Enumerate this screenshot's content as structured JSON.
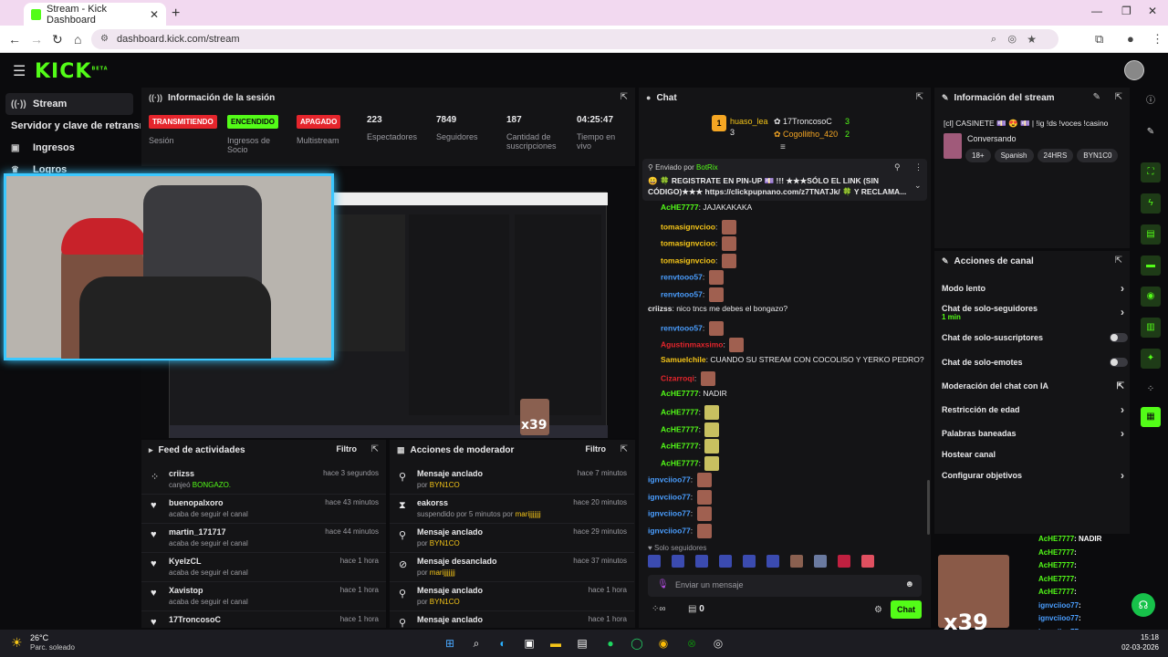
{
  "browser": {
    "tab_title": "Stream - Kick Dashboard",
    "url": "dashboard.kick.com/stream"
  },
  "kick": {
    "logo": "KICK",
    "logo_badge": "BETA"
  },
  "sidebar": {
    "items": [
      {
        "label": "Stream",
        "icon": "broadcast-icon"
      },
      {
        "label": "Servidor y clave de retransmisión",
        "icon": ""
      },
      {
        "label": "Ingresos",
        "icon": "money-icon"
      },
      {
        "label": "Logros",
        "icon": "trophy-icon"
      }
    ]
  },
  "session": {
    "title": "Información de la sesión",
    "cols": [
      {
        "badge": "TRANSMITIENDO",
        "badge_color": "#e5252c",
        "label": "Sesión"
      },
      {
        "badge": "ENCENDIDO",
        "badge_color": "#53fc18",
        "label": "Ingresos de Socio"
      },
      {
        "badge": "APAGADO",
        "badge_color": "#e5252c",
        "label": "Multistream"
      },
      {
        "value": "223",
        "label": "Espectadores"
      },
      {
        "value": "7849",
        "label": "Seguidores"
      },
      {
        "value": "187",
        "label": "Cantidad de suscripciones"
      },
      {
        "value": "04:25:47",
        "label": "Tiempo en vivo"
      }
    ]
  },
  "overlay": {
    "counter": "x39"
  },
  "feed": {
    "title": "Feed de actividades",
    "filter": "Filtro",
    "rows": [
      {
        "name": "criizss",
        "sub_prefix": "canjeó ",
        "sub_highlight": "BONGAZO.",
        "time": "hace 3 segundos",
        "icon": "redeem-icon"
      },
      {
        "name": "buenopalxoro",
        "sub": "acaba de seguir el canal",
        "time": "hace 43 minutos",
        "icon": "heart-icon"
      },
      {
        "name": "martin_171717",
        "sub": "acaba de seguir el canal",
        "time": "hace 44 minutos",
        "icon": "heart-icon"
      },
      {
        "name": "KyelzCL",
        "sub": "acaba de seguir el canal",
        "time": "hace 1 hora",
        "icon": "heart-icon"
      },
      {
        "name": "Xavistop",
        "sub": "acaba de seguir el canal",
        "time": "hace 1 hora",
        "icon": "heart-icon"
      },
      {
        "name": "17TroncosoC",
        "sub": "",
        "time": "hace 1 hora",
        "icon": "heart-icon"
      }
    ]
  },
  "modactions": {
    "title": "Acciones de moderador",
    "filter": "Filtro",
    "rows": [
      {
        "name": "Mensaje anclado",
        "by": "por ",
        "who": "BYN1CO",
        "time": "hace 7 minutos",
        "icon": "pin-icon"
      },
      {
        "name": "eakorss",
        "by": "suspendido por 5 minutos por ",
        "who": "marijjjjjjj",
        "time": "hace 20 minutos",
        "icon": "hourglass-icon"
      },
      {
        "name": "Mensaje anclado",
        "by": "por ",
        "who": "BYN1CO",
        "time": "hace 29 minutos",
        "icon": "pin-icon"
      },
      {
        "name": "Mensaje desanclado",
        "by": "por ",
        "who": "marijjjjjjj",
        "time": "hace 37 minutos",
        "icon": "unpin-icon"
      },
      {
        "name": "Mensaje anclado",
        "by": "por ",
        "who": "BYN1CO",
        "time": "hace 1 hora",
        "icon": "pin-icon"
      },
      {
        "name": "Mensaje anclado",
        "by": "",
        "who": "",
        "time": "hace 1 hora",
        "icon": "pin-icon"
      }
    ]
  },
  "chat": {
    "title": "Chat",
    "top_gifters": [
      {
        "name": "huaso_lea",
        "count": "3"
      },
      {
        "name": "17TroncosoC",
        "count": "3"
      },
      {
        "name": "Cogollitho_420",
        "count": "2"
      }
    ],
    "pinned_by_label": "Enviado por",
    "pinned_by": "BotRix",
    "pinned_text": "😀 🍀 REGISTRATE EN PIN-UP 💷 !!! ★★★SÓLO EL LINK (SIN CÓDIGO)★★★ https://clickpupnano.com/z7TNATJk/ 🍀 Y RECLAMA...",
    "messages": [
      {
        "user": "AcHE7777",
        "color": "#53fc18",
        "text": "JAJAKAKAKA",
        "emote": false
      },
      {
        "user": "tomasignvcioo",
        "color": "#f5c518",
        "text": "",
        "emote": true
      },
      {
        "user": "tomasignvcioo",
        "color": "#f5c518",
        "text": "",
        "emote": true
      },
      {
        "user": "tomasignvcioo",
        "color": "#f5c518",
        "text": "",
        "emote": true
      },
      {
        "user": "renvtooo57",
        "color": "#4a9eff",
        "text": "",
        "emote": true
      },
      {
        "user": "renvtooo57",
        "color": "#4a9eff",
        "text": "",
        "emote": true
      },
      {
        "user": "criizss",
        "color": "#e8e8ea",
        "text": "nico tncs me debes el bongazo?",
        "emote": false
      },
      {
        "user": "renvtooo57",
        "color": "#4a9eff",
        "text": "",
        "emote": true
      },
      {
        "user": "Agustinmaxsimo",
        "color": "#e5252c",
        "text": "",
        "emote": true
      },
      {
        "user": "Samuelchile",
        "color": "#f5c518",
        "text": "CUANDO SU STREAM CON COCOLISO Y YERKO PEDRO?",
        "emote": false
      },
      {
        "user": "Cizarroqi",
        "color": "#e5252c",
        "text": "",
        "emote": true
      },
      {
        "user": "AcHE7777",
        "color": "#53fc18",
        "text": "NADIR",
        "emote": false
      },
      {
        "user": "AcHE7777",
        "color": "#53fc18",
        "text": "",
        "emote": true
      },
      {
        "user": "AcHE7777",
        "color": "#53fc18",
        "text": "",
        "emote": true
      },
      {
        "user": "AcHE7777",
        "color": "#53fc18",
        "text": "",
        "emote": true
      },
      {
        "user": "AcHE7777",
        "color": "#53fc18",
        "text": "",
        "emote": true
      },
      {
        "user": "ignvciioo77",
        "color": "#4a9eff",
        "text": "",
        "emote": true
      },
      {
        "user": "ignvciioo77",
        "color": "#4a9eff",
        "text": "",
        "emote": true
      },
      {
        "user": "ignvciioo77",
        "color": "#4a9eff",
        "text": "",
        "emote": true
      },
      {
        "user": "ignvciioo77",
        "color": "#4a9eff",
        "text": "",
        "emote": true
      }
    ],
    "followers_only": "Solo seguidores",
    "input_placeholder": "Enviar un mensaje",
    "points": "0",
    "send_label": "Chat"
  },
  "streaminfo": {
    "title": "Información del stream",
    "stream_title": "[cl] CASINETE 💷 😍 💷 | !ig !ds !voces !casino",
    "category": "Conversando",
    "tags": [
      "18+",
      "Spanish",
      "24HRS",
      "BYN1C0"
    ]
  },
  "channelactions": {
    "title": "Acciones de canal",
    "items": [
      {
        "label": "Modo lento",
        "control": "chevron"
      },
      {
        "label": "Chat de solo-seguidores",
        "sub": "1 min",
        "control": "chevron"
      },
      {
        "label": "Chat de solo-suscriptores",
        "control": "toggle"
      },
      {
        "label": "Chat de solo-emotes",
        "control": "toggle"
      },
      {
        "label": "Moderación del chat con IA",
        "control": "external"
      },
      {
        "label": "Restricción de edad",
        "control": "chevron"
      },
      {
        "label": "Palabras baneadas",
        "control": "chevron"
      },
      {
        "label": "Hostear canal",
        "control": "none"
      },
      {
        "label": "Configurar objetivos",
        "control": "chevron"
      }
    ]
  },
  "overlay_chat": [
    {
      "user": "AcHE7777",
      "text": ": NADIR"
    },
    {
      "user": "AcHE7777",
      "text": ":"
    },
    {
      "user": "AcHE7777",
      "text": ":"
    },
    {
      "user": "AcHE7777",
      "text": ":"
    },
    {
      "user": "AcHE7777",
      "text": ":"
    },
    {
      "user": "ignvciioo77",
      "text": ":"
    },
    {
      "user": "ignvciioo77",
      "text": ":"
    },
    {
      "user": "ignvciioo77",
      "text": ":"
    }
  ],
  "taskbar": {
    "weather_temp": "26°C",
    "weather_desc": "Parc. soleado",
    "time": "15:18",
    "date": "02-03-2026"
  }
}
